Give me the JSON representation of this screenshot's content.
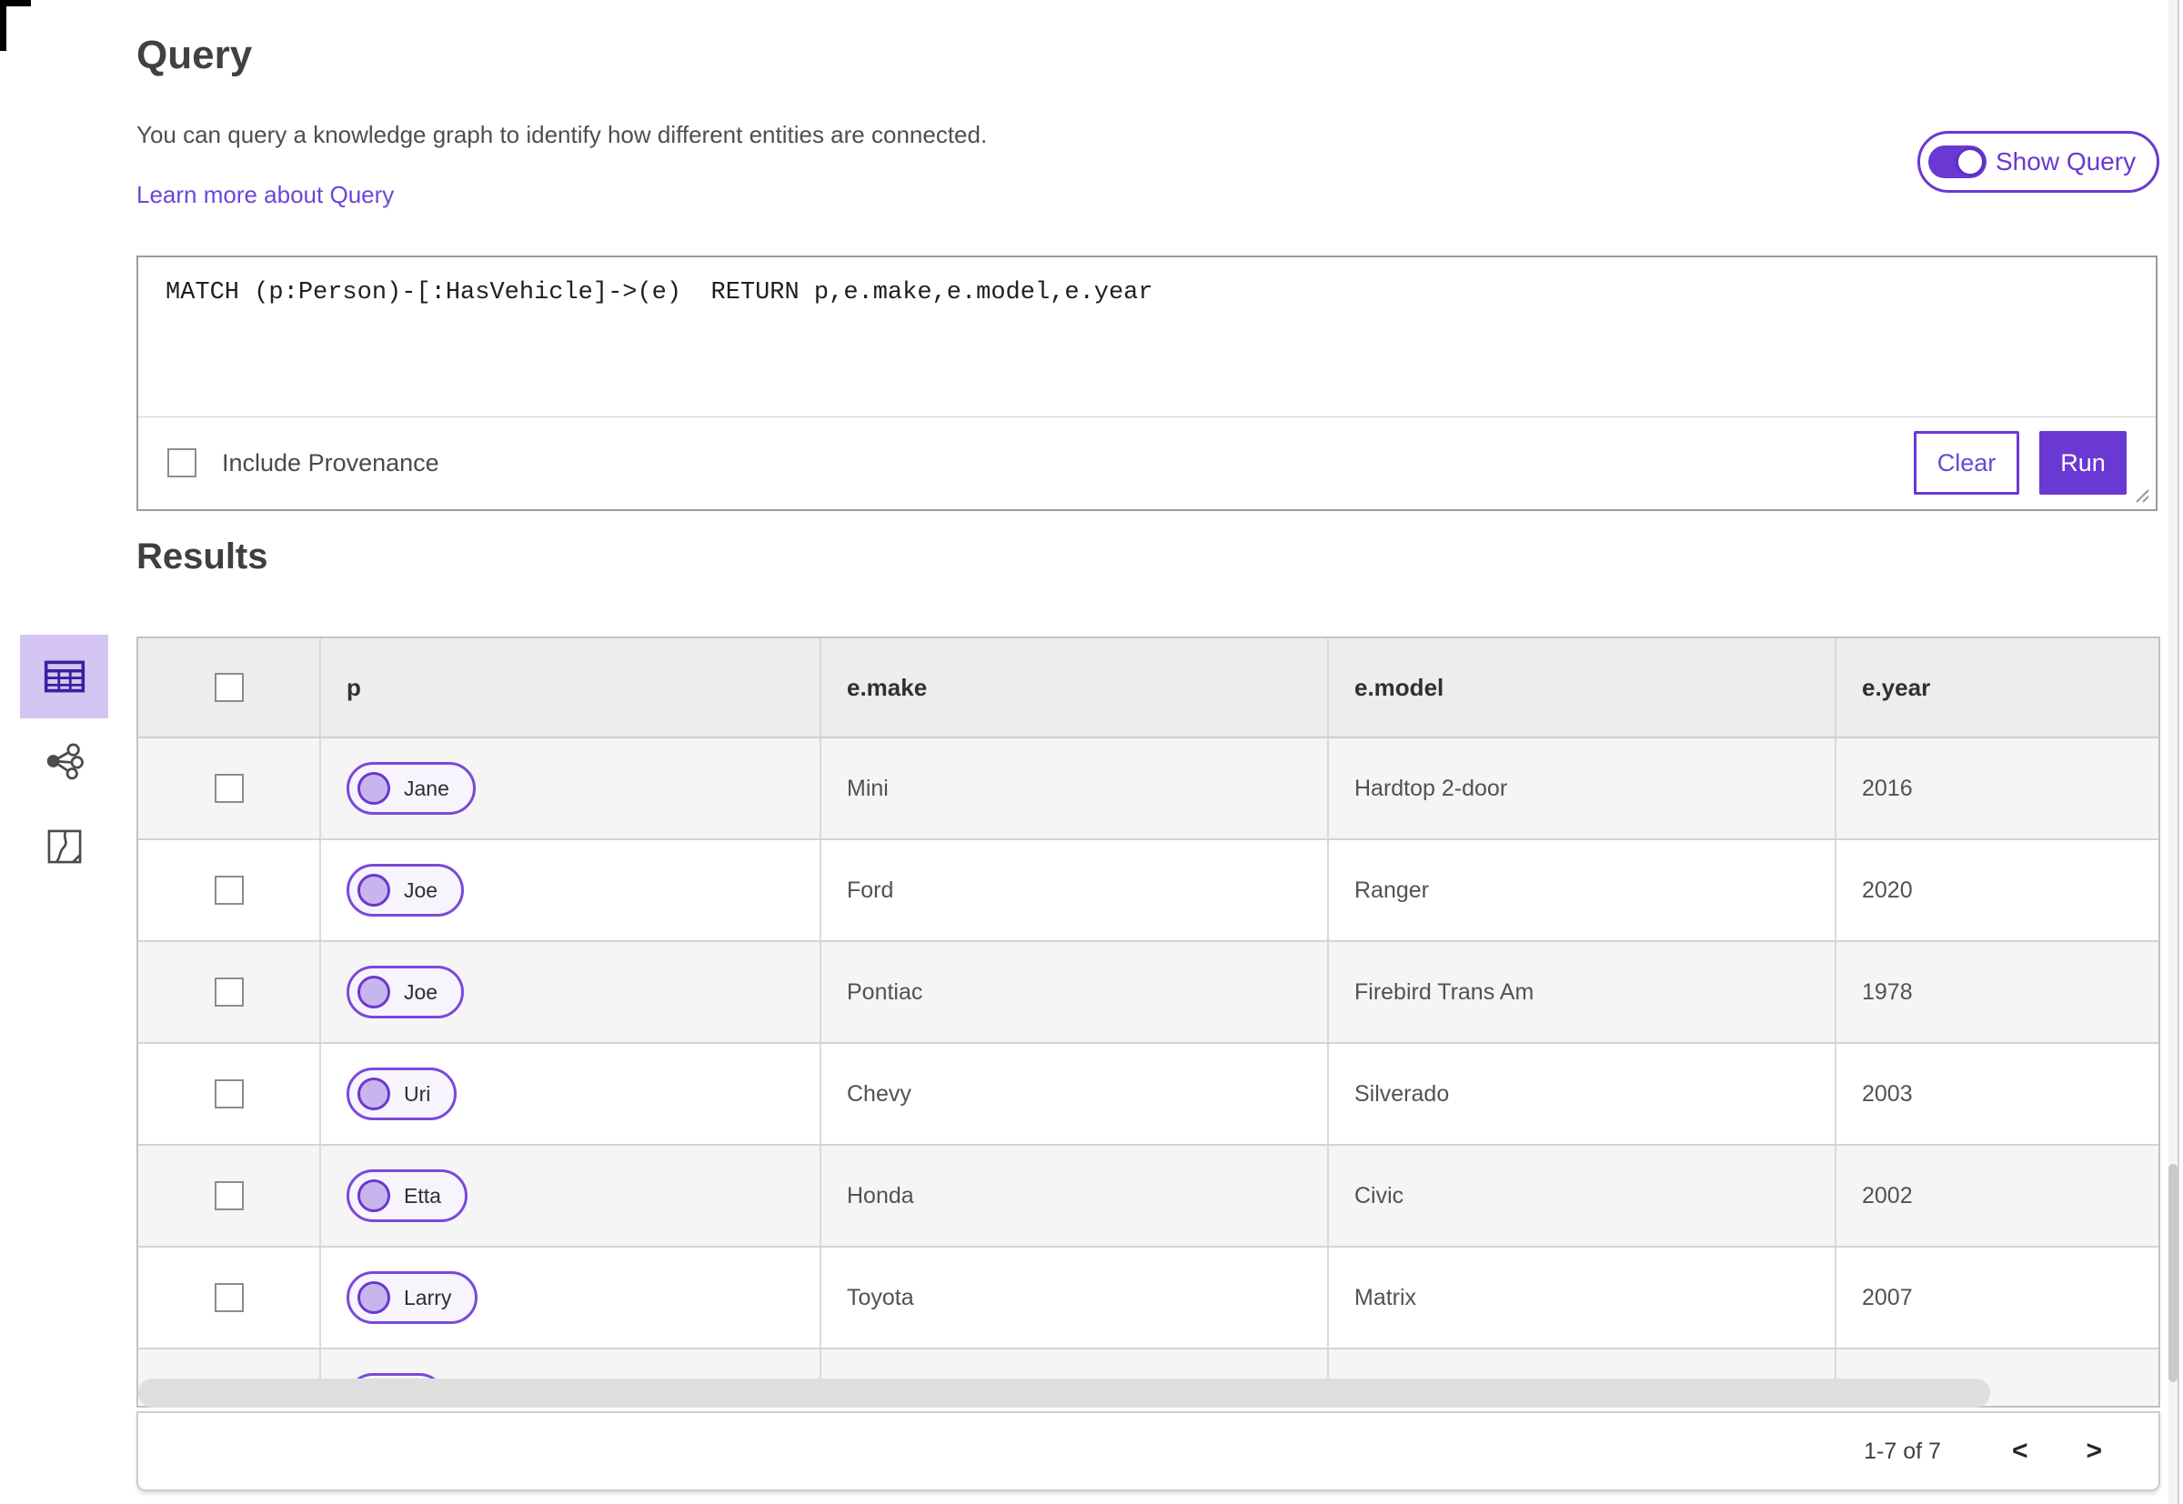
{
  "colors": {
    "accent": "#6a38d2",
    "accent_light_bg": "#d5c5f2",
    "link": "#6b46d9",
    "table_header_bg": "#ededed",
    "row_alt_bg": "#f5f5f5"
  },
  "header": {
    "title": "Query",
    "description": "You can query a knowledge graph to identify how different entities are connected.",
    "learn_more_link": "Learn more about Query",
    "show_query_label": "Show Query",
    "show_query_on": true
  },
  "query_panel": {
    "query_text": "MATCH (p:Person)-[:HasVehicle]->(e)  RETURN p,e.make,e.model,e.year",
    "include_provenance_label": "Include Provenance",
    "include_provenance_checked": false,
    "clear_button": "Clear",
    "run_button": "Run"
  },
  "results": {
    "title": "Results",
    "views": {
      "active": "table-view",
      "items": [
        "table-view-icon",
        "link-chart-view-icon",
        "map-view-icon"
      ]
    },
    "table": {
      "columns": [
        "p",
        "e.make",
        "e.model",
        "e.year"
      ],
      "rows": [
        {
          "p": "Jane",
          "make": "Mini",
          "model": "Hardtop 2-door",
          "year": "2016"
        },
        {
          "p": "Joe",
          "make": "Ford",
          "model": "Ranger",
          "year": "2020"
        },
        {
          "p": "Joe",
          "make": "Pontiac",
          "model": "Firebird Trans Am",
          "year": "1978"
        },
        {
          "p": "Uri",
          "make": "Chevy",
          "model": "Silverado",
          "year": "2003"
        },
        {
          "p": "Etta",
          "make": "Honda",
          "model": "Civic",
          "year": "2002"
        },
        {
          "p": "Larry",
          "make": "Toyota",
          "model": "Matrix",
          "year": "2007"
        }
      ],
      "partial_row_visible": true
    },
    "pagination": {
      "range_label": "1-7 of 7",
      "prev_label": "<",
      "next_label": ">"
    }
  }
}
